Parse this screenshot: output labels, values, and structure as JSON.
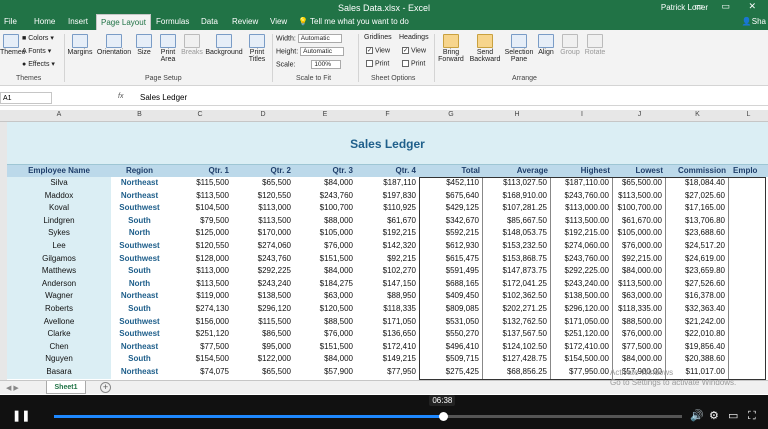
{
  "window": {
    "title": "Sales Data.xlsx - Excel",
    "user": "Patrick Loner",
    "share": "Sha"
  },
  "tabs": [
    "File",
    "Home",
    "Insert",
    "Page Layout",
    "Formulas",
    "Data",
    "Review",
    "View"
  ],
  "tell_me": "Tell me what you want to do",
  "ribbon": {
    "themes": {
      "themes_label": "Themes",
      "colors": "Colors",
      "fonts": "Fonts",
      "effects": "Effects",
      "group": "Themes"
    },
    "page_setup": {
      "margins": "Margins",
      "orientation": "Orientation",
      "size": "Size",
      "print_area": "Print Area",
      "breaks": "Breaks",
      "background": "Background",
      "print_titles": "Print Titles",
      "group": "Page Setup"
    },
    "scale": {
      "width_label": "Width:",
      "width_value": "Automatic",
      "height_label": "Height:",
      "height_value": "Automatic",
      "scale_label": "Scale:",
      "scale_value": "100%",
      "group": "Scale to Fit"
    },
    "sheet_options": {
      "gridlines": "Gridlines",
      "headings": "Headings",
      "view": "View",
      "print": "Print",
      "group": "Sheet Options"
    },
    "arrange": {
      "bring_forward": "Bring Forward",
      "send_backward": "Send Backward",
      "selection_pane": "Selection Pane",
      "align": "Align",
      "group_btn": "Group",
      "rotate": "Rotate",
      "group": "Arrange"
    }
  },
  "formula_bar": {
    "name_box": "A1",
    "fx": "fx",
    "content": "Sales Ledger"
  },
  "columns": [
    "A",
    "B",
    "C",
    "D",
    "E",
    "F",
    "G",
    "H",
    "I",
    "J",
    "K",
    "L"
  ],
  "sheet": {
    "title": "Sales Ledger",
    "headers": [
      "Employee Name",
      "Region",
      "Qtr. 1",
      "Qtr. 2",
      "Qtr. 3",
      "Qtr. 4",
      "Total",
      "Average",
      "Highest",
      "Lowest",
      "Commission",
      "Emplo"
    ],
    "rows": [
      [
        "Silva",
        "Northeast",
        "$115,500",
        "$65,500",
        "$84,000",
        "$187,110",
        "$452,110",
        "$113,027.50",
        "$187,110.00",
        "$65,500.00",
        "$18,084.40"
      ],
      [
        "Maddox",
        "Northeast",
        "$113,500",
        "$120,550",
        "$243,760",
        "$197,830",
        "$675,640",
        "$168,910.00",
        "$243,760.00",
        "$113,500.00",
        "$27,025.60"
      ],
      [
        "Koval",
        "Southwest",
        "$104,500",
        "$113,000",
        "$100,700",
        "$110,925",
        "$429,125",
        "$107,281.25",
        "$113,000.00",
        "$100,700.00",
        "$17,165.00"
      ],
      [
        "Lindgren",
        "South",
        "$79,500",
        "$113,500",
        "$88,000",
        "$61,670",
        "$342,670",
        "$85,667.50",
        "$113,500.00",
        "$61,670.00",
        "$13,706.80"
      ],
      [
        "Sykes",
        "North",
        "$125,000",
        "$170,000",
        "$105,000",
        "$192,215",
        "$592,215",
        "$148,053.75",
        "$192,215.00",
        "$105,000.00",
        "$23,688.60"
      ],
      [
        "Lee",
        "Southwest",
        "$120,550",
        "$274,060",
        "$76,000",
        "$142,320",
        "$612,930",
        "$153,232.50",
        "$274,060.00",
        "$76,000.00",
        "$24,517.20"
      ],
      [
        "Gilgamos",
        "Southwest",
        "$128,000",
        "$243,760",
        "$151,500",
        "$92,215",
        "$615,475",
        "$153,868.75",
        "$243,760.00",
        "$92,215.00",
        "$24,619.00"
      ],
      [
        "Matthews",
        "South",
        "$113,000",
        "$292,225",
        "$84,000",
        "$102,270",
        "$591,495",
        "$147,873.75",
        "$292,225.00",
        "$84,000.00",
        "$23,659.80"
      ],
      [
        "Anderson",
        "North",
        "$113,500",
        "$243,240",
        "$184,275",
        "$147,150",
        "$688,165",
        "$172,041.25",
        "$243,240.00",
        "$113,500.00",
        "$27,526.60"
      ],
      [
        "Wagner",
        "Northeast",
        "$119,000",
        "$138,500",
        "$63,000",
        "$88,950",
        "$409,450",
        "$102,362.50",
        "$138,500.00",
        "$63,000.00",
        "$16,378.00"
      ],
      [
        "Roberts",
        "South",
        "$274,130",
        "$296,120",
        "$120,500",
        "$118,335",
        "$809,085",
        "$202,271.25",
        "$296,120.00",
        "$118,335.00",
        "$32,363.40"
      ],
      [
        "Avellone",
        "Southwest",
        "$156,000",
        "$115,500",
        "$88,500",
        "$171,050",
        "$531,050",
        "$132,762.50",
        "$171,050.00",
        "$88,500.00",
        "$21,242.00"
      ],
      [
        "Clarke",
        "Southwest",
        "$251,120",
        "$86,500",
        "$76,000",
        "$136,650",
        "$550,270",
        "$137,567.50",
        "$251,120.00",
        "$76,000.00",
        "$22,010.80"
      ],
      [
        "Chen",
        "Northeast",
        "$77,500",
        "$95,000",
        "$151,500",
        "$172,410",
        "$496,410",
        "$124,102.50",
        "$172,410.00",
        "$77,500.00",
        "$19,856.40"
      ],
      [
        "Nguyen",
        "South",
        "$154,500",
        "$122,000",
        "$84,000",
        "$149,215",
        "$509,715",
        "$127,428.75",
        "$154,500.00",
        "$84,000.00",
        "$20,388.60"
      ],
      [
        "Basara",
        "Northeast",
        "$74,075",
        "$65,500",
        "$57,900",
        "$77,950",
        "$275,425",
        "$68,856.25",
        "$77,950.00",
        "$57,900.00",
        "$11,017.00"
      ]
    ]
  },
  "sheet_tab": "Sheet1",
  "activation": {
    "line1": "Activate Windows",
    "line2": "Go to Settings to activate Windows."
  },
  "player": {
    "time": "06:38",
    "progress": 0.62
  }
}
